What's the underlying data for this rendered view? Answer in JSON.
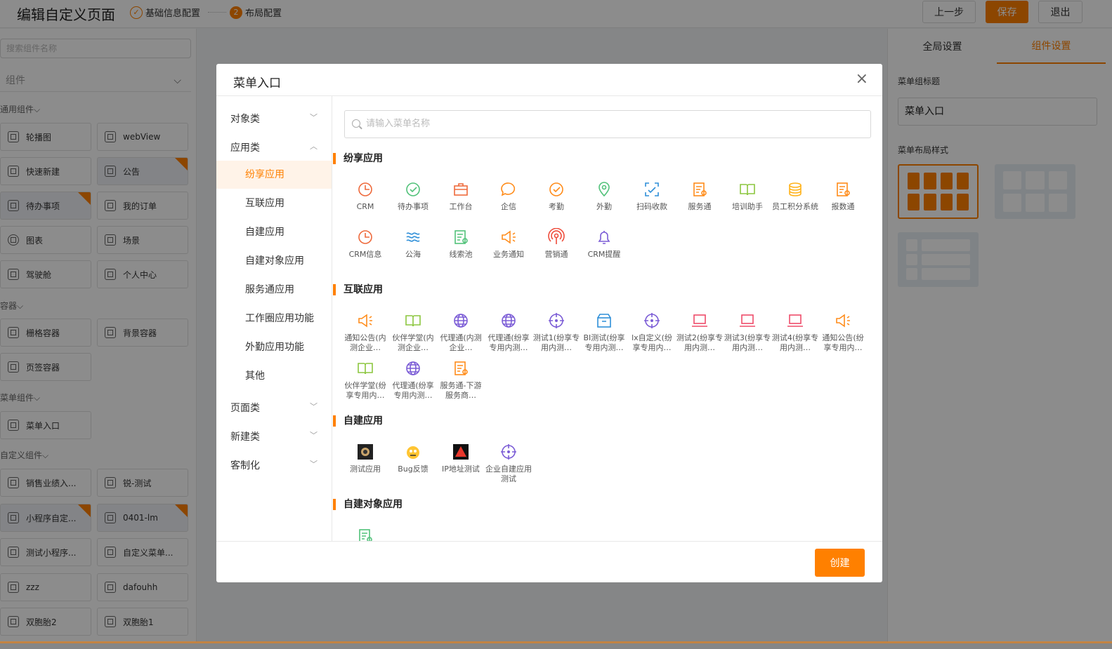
{
  "header": {
    "title": "编辑自定义页面",
    "step1": "基础信息配置",
    "step2_num": "2",
    "step2": "布局配置",
    "prev": "上一步",
    "save": "保存",
    "exit": "退出"
  },
  "left": {
    "search_placeholder": "搜索组件名称",
    "component_select": "组件",
    "sections": [
      {
        "title": "通用组件",
        "items": [
          "轮播图",
          "webView",
          "快速新建",
          "公告",
          "待办事项",
          "我的订单",
          "图表",
          "场景",
          "驾驶舱",
          "个人中心"
        ]
      },
      {
        "title": "容器",
        "items": [
          "栅格容器",
          "背景容器",
          "页签容器"
        ]
      },
      {
        "title": "菜单组件",
        "items": [
          "菜单入口"
        ]
      },
      {
        "title": "自定义组件",
        "items": [
          "销售业绩入...",
          "锐-测试",
          "小程序自定...",
          "0401-lm",
          "测试小程序...",
          "自定义菜单...",
          "zzz",
          "dafouhh",
          "双胞胎2",
          "双胞胎1"
        ]
      }
    ]
  },
  "right": {
    "tab_global": "全局设置",
    "tab_component": "组件设置",
    "menu_title_label": "菜单组标题",
    "menu_title_value": "菜单入口",
    "layout_label": "菜单布局样式"
  },
  "modal": {
    "title": "菜单入口",
    "close": "×",
    "nav": {
      "g_object": "对象类",
      "g_app": "应用类",
      "items": [
        "纷享应用",
        "互联应用",
        "自建应用",
        "自建对象应用",
        "服务通应用",
        "工作圈应用功能",
        "外勤应用功能",
        "其他"
      ],
      "g_page": "页面类",
      "g_new": "新建类",
      "g_custom": "客制化"
    },
    "search_placeholder": "请输入菜单名称",
    "categories": [
      {
        "title": "纷享应用",
        "apps": [
          "CRM",
          "待办事项",
          "工作台",
          "企信",
          "考勤",
          "外勤",
          "扫码收款",
          "服务通",
          "培训助手",
          "员工积分系统",
          "报数通",
          "CRM信息",
          "公海",
          "线索池",
          "业务通知",
          "营销通",
          "CRM提醒"
        ]
      },
      {
        "title": "互联应用",
        "apps": [
          "通知公告(内测企业…",
          "伙伴学堂(内测企业…",
          "代理通(内测企业…",
          "代理通(纷享专用内测…",
          "测试1(纷享专用内测…",
          "BI测试(纷享专用内测…",
          "lx自定义(纷享专用内…",
          "测试2(纷享专用内测…",
          "测试3(纷享专用内测…",
          "测试4(纷享专用内测…",
          "通知公告(纷享专用内…",
          "伙伴学堂(纷享专用内…",
          "代理通(纷享专用内测…",
          "服务通-下游服务商…"
        ]
      },
      {
        "title": "自建应用",
        "apps": [
          "测试应用",
          "Bug反馈",
          "IP地址测试",
          "企业自建应用测试"
        ]
      },
      {
        "title": "自建对象应用",
        "apps": []
      }
    ],
    "create": "创建"
  },
  "colors": {
    "accent": "#ff8000"
  }
}
